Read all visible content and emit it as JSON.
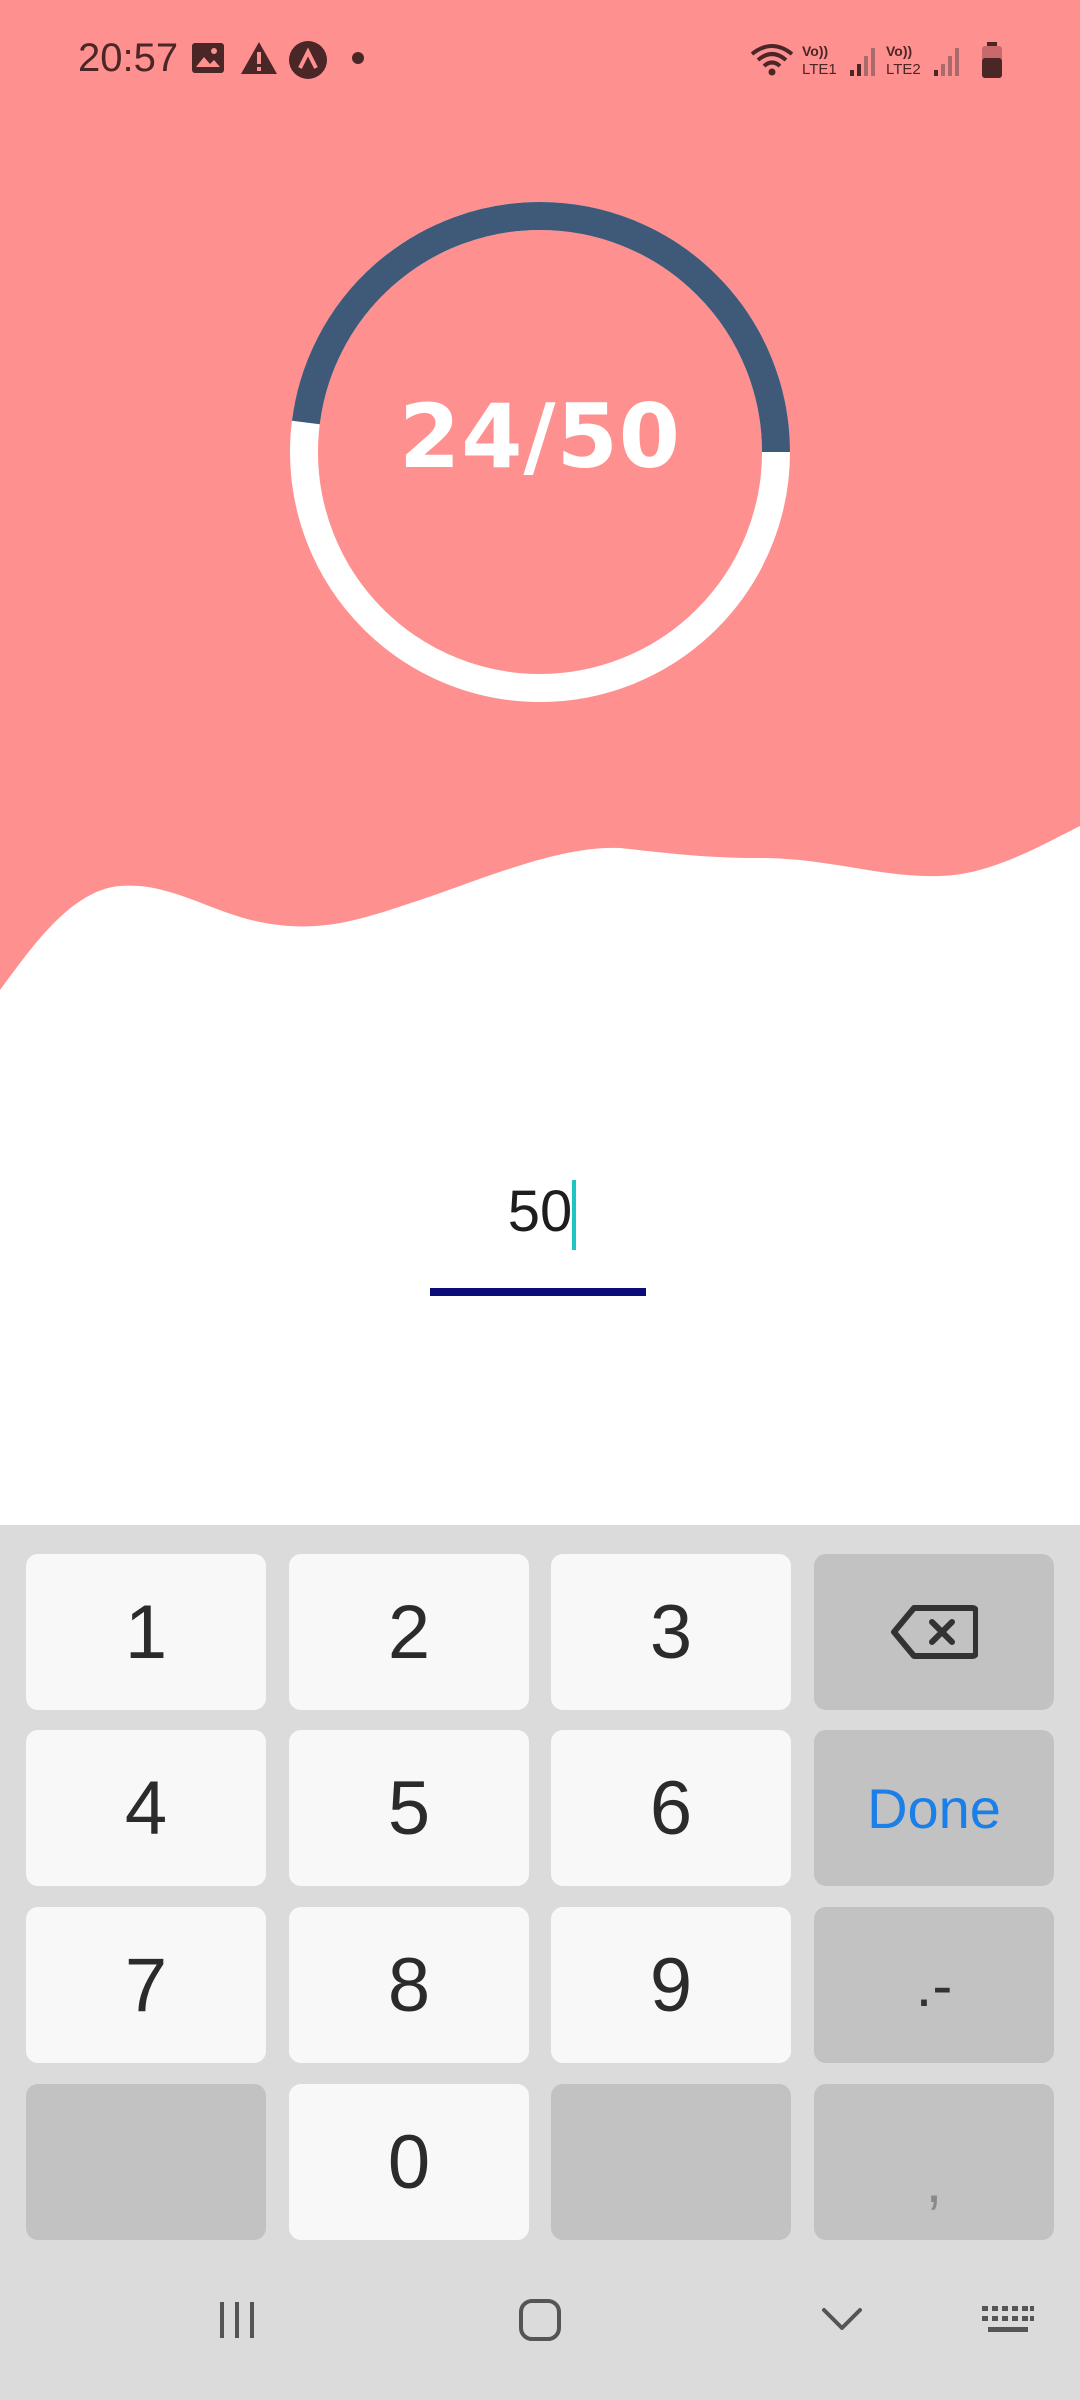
{
  "status_bar": {
    "time": "20:57",
    "icons": [
      "gallery-icon",
      "alert-icon",
      "app-icon",
      "notification-dot",
      "wifi-icon",
      "volte-lte1-icon",
      "signal-1-icon",
      "volte-lte2-icon",
      "signal-2-icon",
      "battery-icon"
    ],
    "lte1_label": "Vo)) LTE1",
    "lte2_label": "Vo)) LTE2"
  },
  "progress": {
    "text": "24/50",
    "current": 24,
    "total": 50,
    "fraction": 0.48
  },
  "goal_input": {
    "value": "50"
  },
  "keyboard": {
    "rows": [
      [
        "1",
        "2",
        "3",
        "backspace"
      ],
      [
        "4",
        "5",
        "6",
        "Done"
      ],
      [
        "7",
        "8",
        "9",
        ".-"
      ],
      [
        "",
        "0",
        "",
        ","
      ]
    ],
    "keys": {
      "k1": "1",
      "k2": "2",
      "k3": "3",
      "k4": "4",
      "k5": "5",
      "k6": "6",
      "k7": "7",
      "k8": "8",
      "k9": "9",
      "k0": "0",
      "done": "Done",
      "dot_minus": ".-",
      "comma": ","
    }
  },
  "nav_bar": {
    "buttons": [
      "recent-apps-icon",
      "home-icon",
      "back-icon",
      "keyboard-switch-icon"
    ]
  },
  "colors": {
    "background_top": "#ff9090",
    "ring_progress": "#3f5a78",
    "ring_track": "#ffffff",
    "input_underline": "#0b0b7a",
    "caret": "#1fc4c4",
    "done_key": "#1a7fe8"
  }
}
